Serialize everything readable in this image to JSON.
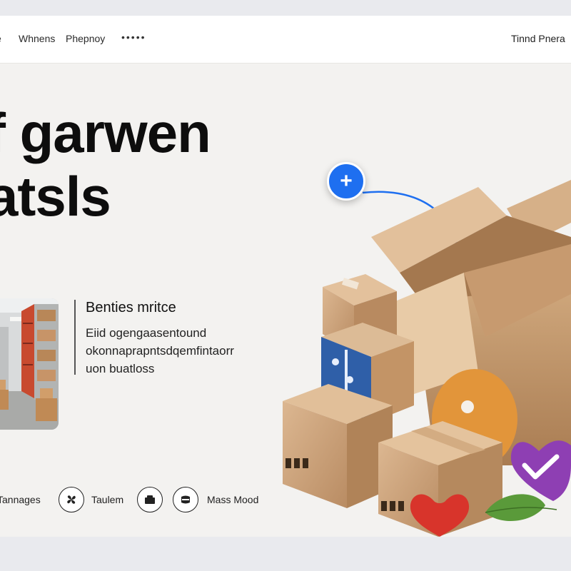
{
  "nav": {
    "items": [
      "e",
      "Whnens",
      "Phepnoy"
    ],
    "more": "•••••",
    "right_link": "Tinnd Pnera"
  },
  "hero": {
    "title_lines": [
      "f garwen",
      "atsls"
    ]
  },
  "benefits": {
    "title": "Benties mritce",
    "body_lines": [
      "Eiid ogengaasentound",
      "okonnaprapntsdqemfintaorr",
      "uon buatloss"
    ]
  },
  "bottom_row": {
    "items": [
      {
        "label": "Tannages"
      },
      {
        "label": "Taulem",
        "icon": "fan-icon"
      },
      {
        "icon": "box-icon"
      },
      {
        "icon": "package-icon",
        "label": "Mass Mood"
      }
    ]
  },
  "colors": {
    "accent": "#1e6ff0",
    "cardboard": "#c9a27a",
    "background": "#f3f2f0",
    "heart_purple": "#8e3fb3",
    "heart_red": "#d8342b"
  },
  "icons": {
    "plus": "+",
    "add": "plus-icon"
  }
}
